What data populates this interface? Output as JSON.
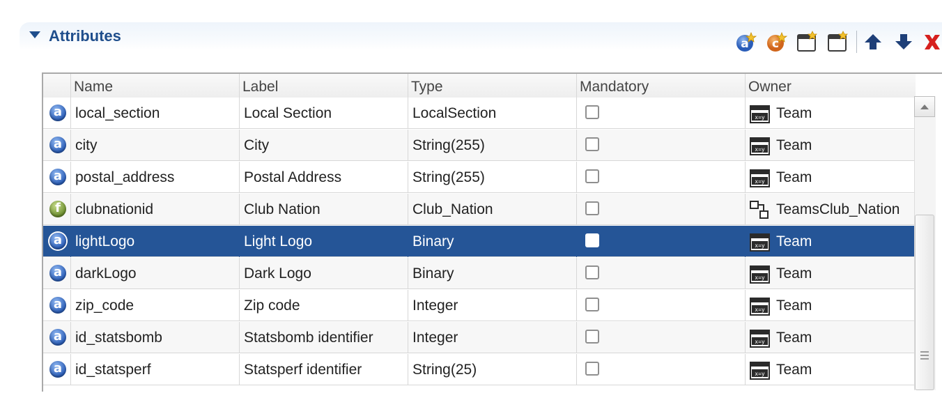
{
  "section": {
    "title": "Attributes"
  },
  "toolbar": {
    "buttons": [
      {
        "name": "add-attribute-button",
        "icon": "add-attribute-icon"
      },
      {
        "name": "add-computed-attribute-button",
        "icon": "add-computed-icon"
      },
      {
        "name": "new-item-button",
        "icon": "window-new-icon"
      },
      {
        "name": "new-item-2-button",
        "icon": "window-new-icon"
      },
      {
        "name": "move-up-button",
        "icon": "arrow-up-icon"
      },
      {
        "name": "move-down-button",
        "icon": "arrow-down-icon"
      },
      {
        "name": "delete-button",
        "icon": "delete-x-icon"
      }
    ]
  },
  "grid": {
    "columns": [
      "Name",
      "Label",
      "Type",
      "Mandatory",
      "Owner"
    ],
    "rows": [
      {
        "name": "local_section",
        "label": "Local Section",
        "type": "LocalSection",
        "mandatory": false,
        "owner": "Team",
        "kind": "a",
        "owner_icon": "entity-icon"
      },
      {
        "name": "city",
        "label": "City",
        "type": "String(255)",
        "mandatory": false,
        "owner": "Team",
        "kind": "a",
        "owner_icon": "entity-icon"
      },
      {
        "name": "postal_address",
        "label": "Postal Address",
        "type": "String(255)",
        "mandatory": false,
        "owner": "Team",
        "kind": "a",
        "owner_icon": "entity-icon"
      },
      {
        "name": "clubnationid",
        "label": "Club Nation",
        "type": "Club_Nation",
        "mandatory": false,
        "owner": "TeamsClub_Nation",
        "kind": "f",
        "owner_icon": "relation-icon"
      },
      {
        "name": "lightLogo",
        "label": "Light Logo",
        "type": "Binary",
        "mandatory": false,
        "owner": "Team",
        "kind": "a",
        "owner_icon": "entity-icon",
        "selected": true
      },
      {
        "name": "darkLogo",
        "label": "Dark Logo",
        "type": "Binary",
        "mandatory": false,
        "owner": "Team",
        "kind": "a",
        "owner_icon": "entity-icon"
      },
      {
        "name": "zip_code",
        "label": "Zip code",
        "type": "Integer",
        "mandatory": false,
        "owner": "Team",
        "kind": "a",
        "owner_icon": "entity-icon"
      },
      {
        "name": "id_statsbomb",
        "label": "Statsbomb identifier",
        "type": "Integer",
        "mandatory": false,
        "owner": "Team",
        "kind": "a",
        "owner_icon": "entity-icon"
      },
      {
        "name": "id_statsperf",
        "label": "Statsperf identifier",
        "type": "String(25)",
        "mandatory": false,
        "owner": "Team",
        "kind": "a",
        "owner_icon": "entity-icon"
      }
    ]
  }
}
